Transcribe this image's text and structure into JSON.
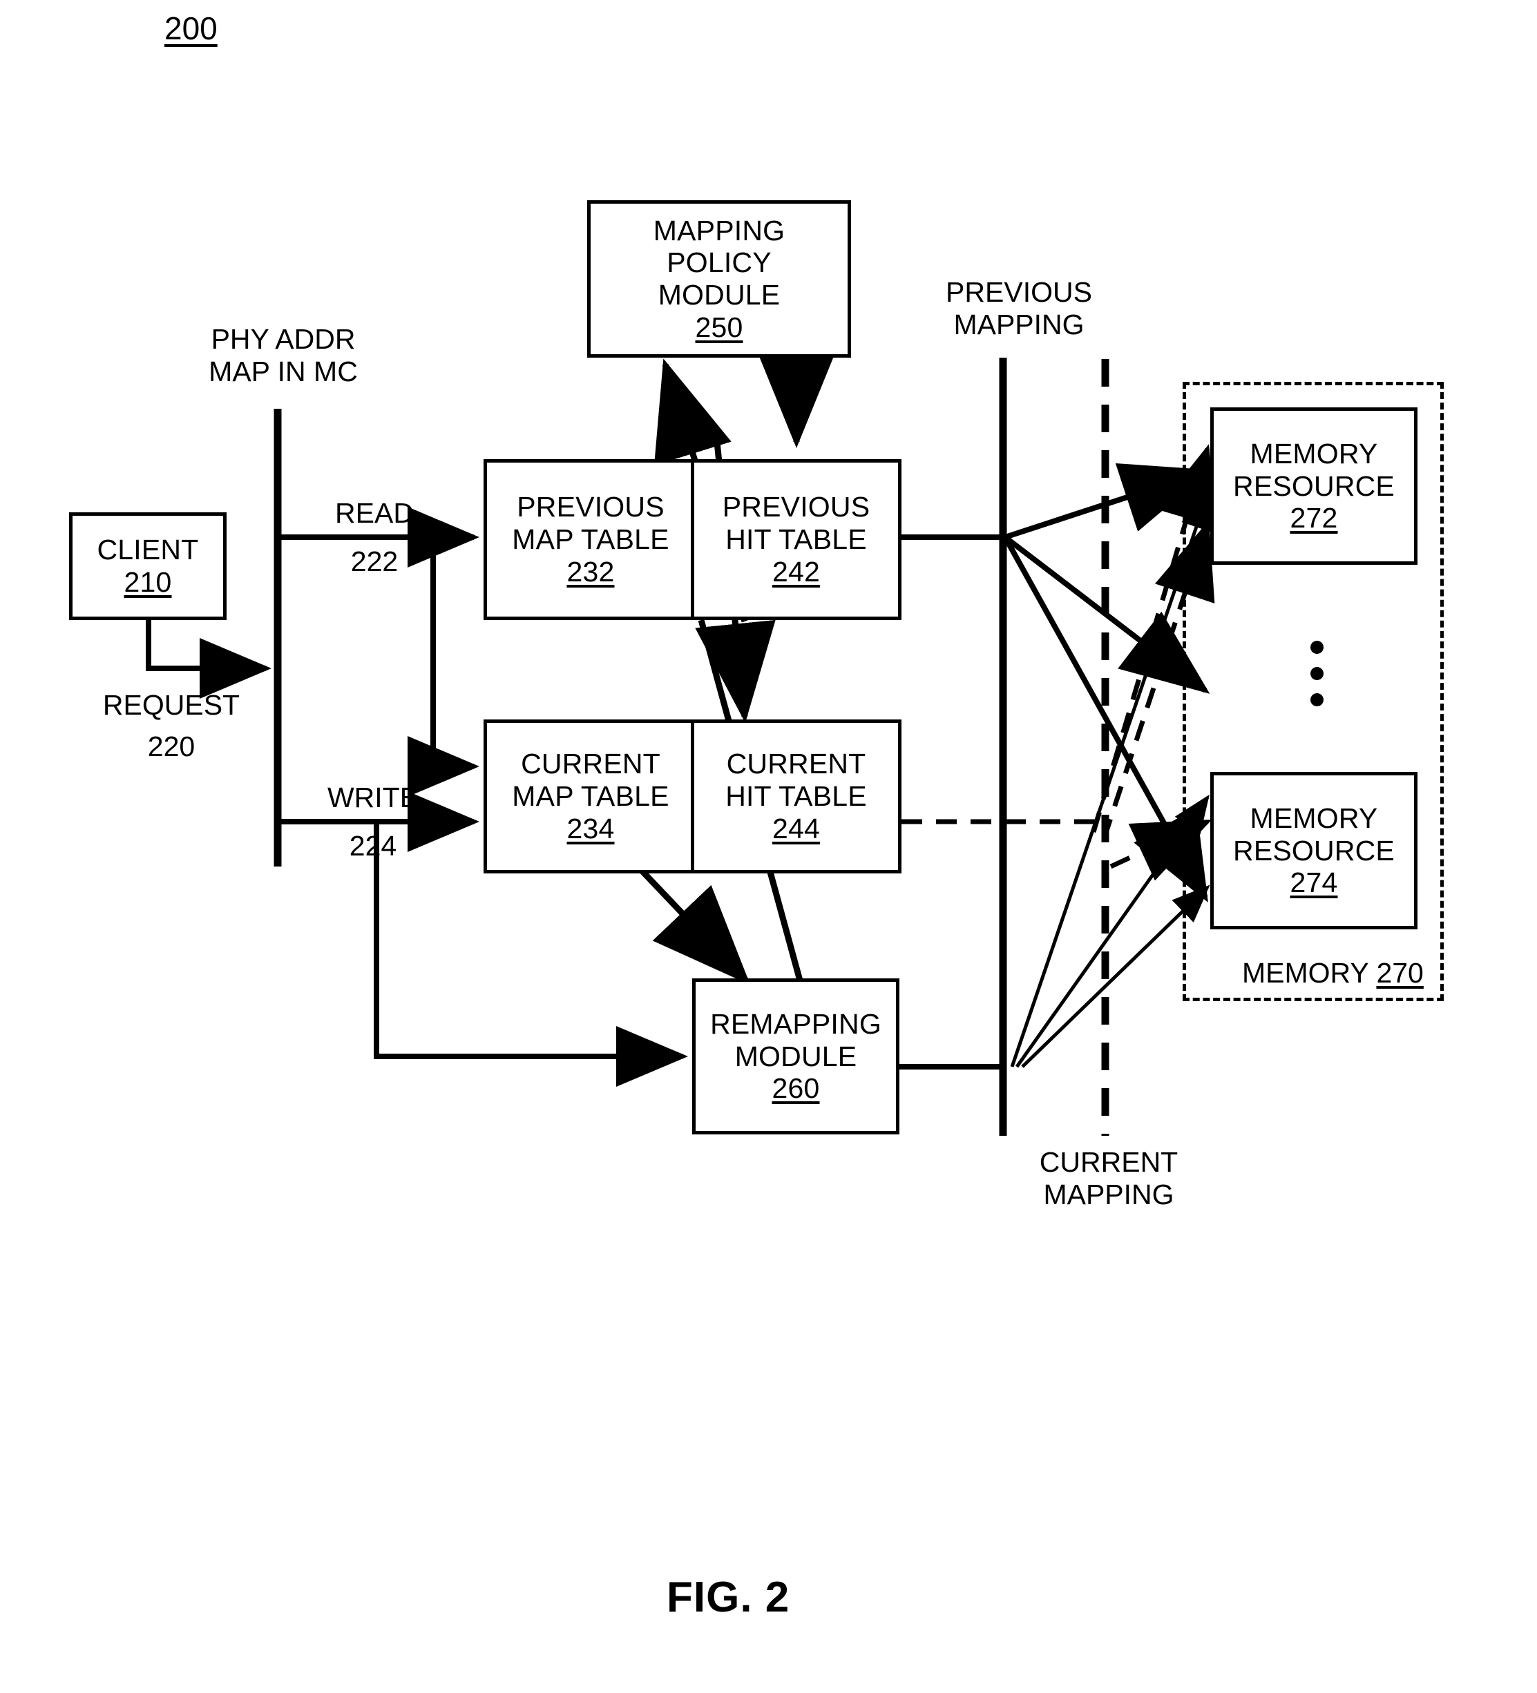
{
  "figure": {
    "number": "200",
    "caption": "FIG. 2"
  },
  "nodes": {
    "client": {
      "line1": "CLIENT",
      "ref": "210"
    },
    "mapping_policy_module": {
      "line1": "MAPPING",
      "line2": "POLICY",
      "line3": "MODULE",
      "ref": "250"
    },
    "previous_map_table": {
      "line1": "PREVIOUS",
      "line2": "MAP TABLE",
      "ref": "232"
    },
    "previous_hit_table": {
      "line1": "PREVIOUS",
      "line2": "HIT TABLE",
      "ref": "242"
    },
    "current_map_table": {
      "line1": "CURRENT",
      "line2": "MAP TABLE",
      "ref": "234"
    },
    "current_hit_table": {
      "line1": "CURRENT",
      "line2": "HIT TABLE",
      "ref": "244"
    },
    "remapping_module": {
      "line1": "REMAPPING",
      "line2": "MODULE",
      "ref": "260"
    },
    "memory_resource_272": {
      "line1": "MEMORY",
      "line2": "RESOURCE",
      "ref": "272"
    },
    "memory_resource_274": {
      "line1": "MEMORY",
      "line2": "RESOURCE",
      "ref": "274"
    },
    "memory_group": {
      "label": "MEMORY",
      "ref": "270"
    }
  },
  "labels": {
    "phy_addr_map": {
      "line1": "PHY ADDR",
      "line2": "MAP IN MC"
    },
    "read": {
      "text": "READ",
      "ref": "222"
    },
    "write": {
      "text": "WRITE",
      "ref": "224"
    },
    "request": {
      "text": "REQUEST",
      "ref": "220"
    },
    "previous_mapping": {
      "line1": "PREVIOUS",
      "line2": "MAPPING"
    },
    "current_mapping": {
      "line1": "CURRENT",
      "line2": "MAPPING"
    }
  },
  "colors": {
    "stroke": "#000000",
    "background": "#ffffff"
  }
}
